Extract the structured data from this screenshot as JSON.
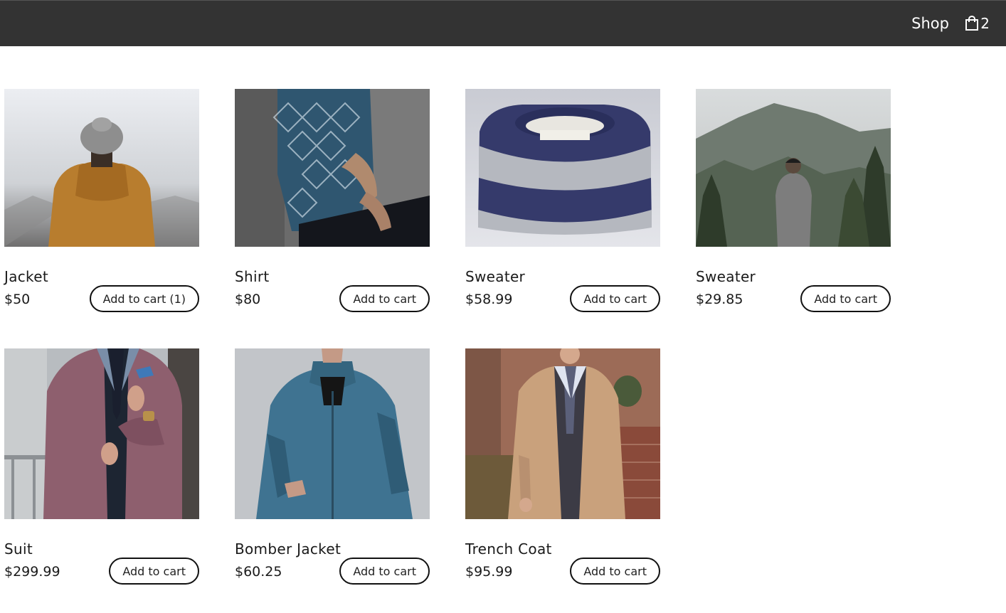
{
  "header": {
    "shop_label": "Shop",
    "cart_icon": "shopping-bag-icon",
    "cart_count": "2"
  },
  "products": [
    {
      "name": "Jacket",
      "price": "$50",
      "button_label": "Add to cart (1)",
      "image": "person-in-brown-hooded-jacket-and-beanie-foggy-forest"
    },
    {
      "name": "Shirt",
      "price": "$80",
      "button_label": "Add to cart",
      "image": "man-in-patterned-blue-shirt-against-concrete-wall"
    },
    {
      "name": "Sweater",
      "price": "$58.99",
      "button_label": "Add to cart",
      "image": "folded-navy-and-grey-striped-knit-sweater"
    },
    {
      "name": "Sweater",
      "price": "$29.85",
      "button_label": "Add to cart",
      "image": "man-in-grey-sweater-facing-misty-mountain"
    },
    {
      "name": "Suit",
      "price": "$299.99",
      "button_label": "Add to cart",
      "image": "man-in-pink-tweed-blazer-adjusting-cuff"
    },
    {
      "name": "Bomber Jacket",
      "price": "$60.25",
      "button_label": "Add to cart",
      "image": "man-in-teal-bomber-jacket"
    },
    {
      "name": "Trench Coat",
      "price": "$95.99",
      "button_label": "Add to cart",
      "image": "man-in-beige-trench-coat-against-brick-wall"
    }
  ]
}
